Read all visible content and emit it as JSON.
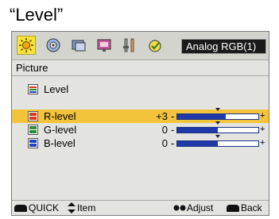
{
  "caption": "“Level”",
  "topbar": {
    "icons": [
      {
        "name": "picture-icon",
        "active": true
      },
      {
        "name": "audio-icon",
        "active": false
      },
      {
        "name": "setup-icon",
        "active": false
      },
      {
        "name": "screen-icon",
        "active": false
      },
      {
        "name": "option-icon",
        "active": false
      },
      {
        "name": "power-icon",
        "active": false
      }
    ],
    "input_label": "Analog RGB(1)"
  },
  "section_title": "Picture",
  "level_heading": "Level",
  "rows": [
    {
      "label": "R-level",
      "value": "+3",
      "level": 0.6,
      "selected": true,
      "color": "#d63a1c"
    },
    {
      "label": "G-level",
      "value": "0",
      "level": 0.5,
      "selected": false,
      "color": "#2e8b3a"
    },
    {
      "label": "B-level",
      "value": "0",
      "level": 0.5,
      "selected": false,
      "color": "#2446b8"
    }
  ],
  "footer": {
    "quick": "QUICK",
    "item": "Item",
    "adjust": "Adjust",
    "back": "Back"
  },
  "colors": {
    "highlight": "#f3c43b",
    "active_tab": "#f7e43b",
    "slider_fill": "#1f3aa8"
  }
}
